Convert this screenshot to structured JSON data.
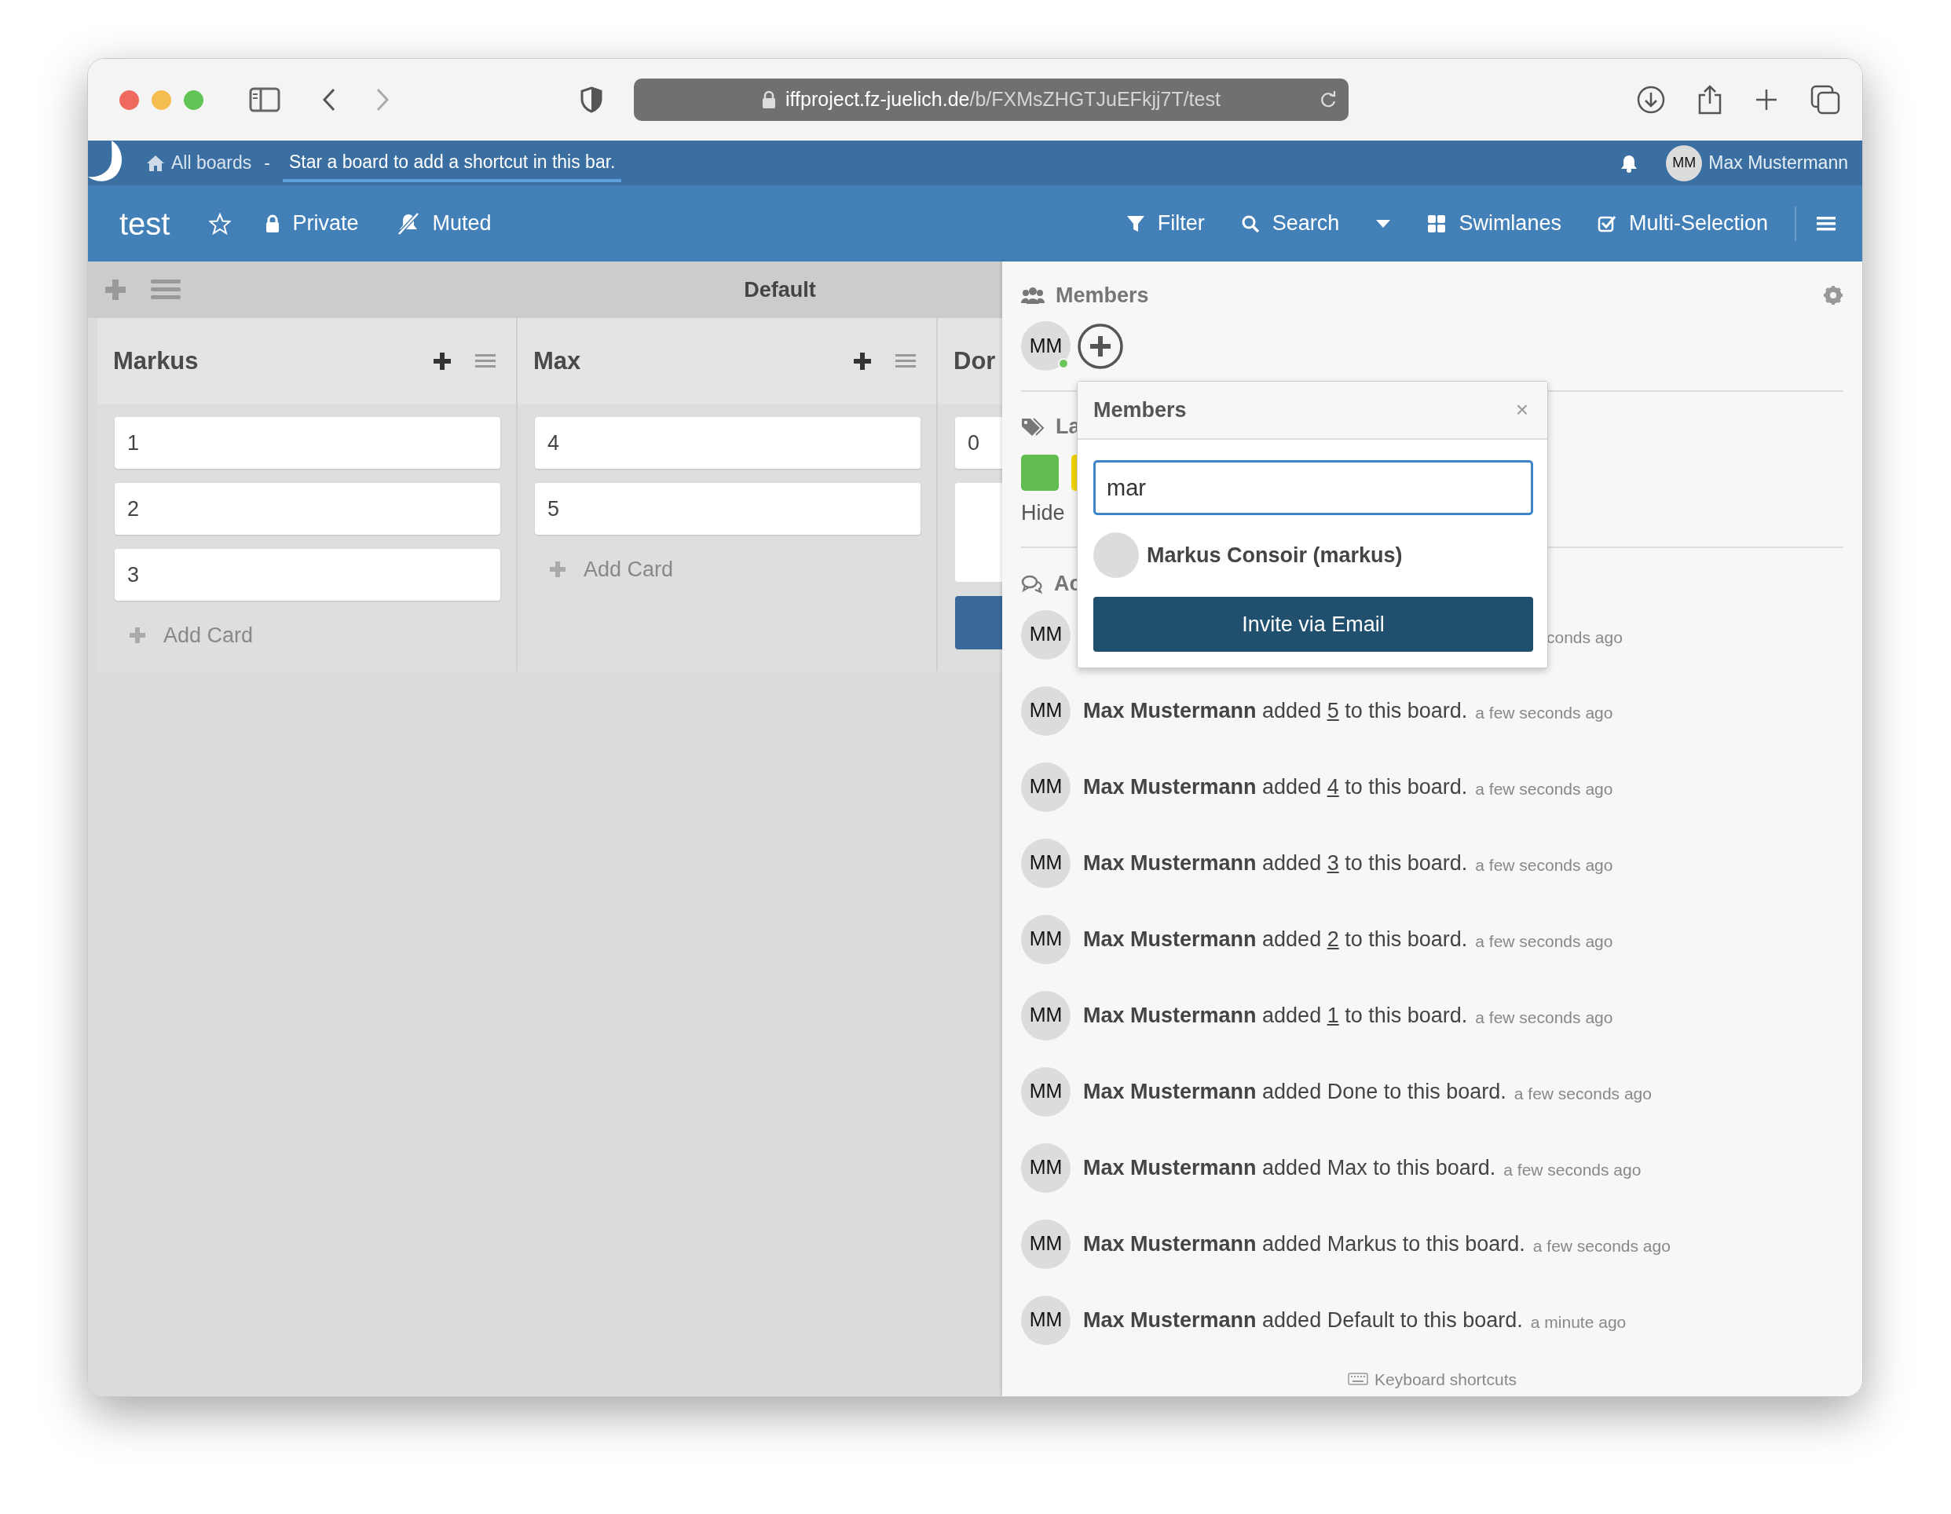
{
  "browser": {
    "url_host": "iffproject.fz-juelich.de",
    "url_path": "/b/FXMsZHGTJuEFkjj7T/test"
  },
  "header": {
    "all_boards": "All boards",
    "separator": "-",
    "shortcut_hint": "Star a board to add a shortcut in this bar.",
    "user": {
      "initials": "MM",
      "name": "Max Mustermann"
    }
  },
  "board_bar": {
    "title": "test",
    "starred": false,
    "visibility": "Private",
    "watch": "Muted",
    "actions": [
      {
        "kind": "filter",
        "label": "Filter"
      },
      {
        "kind": "search",
        "label": "Search"
      },
      {
        "kind": "caret"
      },
      {
        "kind": "swimlanes",
        "label": "Swimlanes"
      },
      {
        "kind": "multiselect",
        "label": "Multi-Selection"
      }
    ]
  },
  "swimlane": {
    "title": "Default",
    "lists": [
      {
        "title": "Markus",
        "cards": [
          "1",
          "2",
          "3"
        ],
        "add_card": "Add Card",
        "composer_open": false
      },
      {
        "title": "Max",
        "cards": [
          "4",
          "5"
        ],
        "add_card": "Add Card",
        "composer_open": false
      },
      {
        "title": "Dor",
        "cards": [
          "0"
        ],
        "composer_open": true
      }
    ]
  },
  "sidebar": {
    "members_title": "Members",
    "members": [
      {
        "initials": "MM",
        "online": true
      }
    ],
    "labels_title": "La",
    "labels": [
      {
        "color": "#61bd4f"
      },
      {
        "color": "#f2d600"
      }
    ],
    "hide_text": "Hide",
    "activities_title": "Ac",
    "activities": [
      {
        "kind": "covered",
        "initials": "MM",
        "time": "conds ago"
      },
      {
        "kind": "full",
        "initials": "MM",
        "actor": "Max Mustermann",
        "verb": "added",
        "target": "5",
        "target_link": true,
        "rest": "to this board.",
        "time": "a few seconds ago"
      },
      {
        "kind": "full",
        "initials": "MM",
        "actor": "Max Mustermann",
        "verb": "added",
        "target": "4",
        "target_link": true,
        "rest": "to this board.",
        "time": "a few seconds ago"
      },
      {
        "kind": "full",
        "initials": "MM",
        "actor": "Max Mustermann",
        "verb": "added",
        "target": "3",
        "target_link": true,
        "rest": "to this board.",
        "time": "a few seconds ago"
      },
      {
        "kind": "full",
        "initials": "MM",
        "actor": "Max Mustermann",
        "verb": "added",
        "target": "2",
        "target_link": true,
        "rest": "to this board.",
        "time": "a few seconds ago"
      },
      {
        "kind": "full",
        "initials": "MM",
        "actor": "Max Mustermann",
        "verb": "added",
        "target": "1",
        "target_link": true,
        "rest": "to this board.",
        "time": "a few seconds ago"
      },
      {
        "kind": "full",
        "initials": "MM",
        "actor": "Max Mustermann",
        "verb": "added",
        "target": "Done",
        "target_link": false,
        "rest": "to this board.",
        "time": "a few seconds ago"
      },
      {
        "kind": "full",
        "initials": "MM",
        "actor": "Max Mustermann",
        "verb": "added",
        "target": "Max",
        "target_link": false,
        "rest": "to this board.",
        "time": "a few seconds ago"
      },
      {
        "kind": "full",
        "initials": "MM",
        "actor": "Max Mustermann",
        "verb": "added",
        "target": "Markus",
        "target_link": false,
        "rest": "to this board.",
        "time": "a few seconds ago"
      },
      {
        "kind": "full",
        "initials": "MM",
        "actor": "Max Mustermann",
        "verb": "added",
        "target": "Default",
        "target_link": false,
        "rest": "to this board.",
        "time": "a minute ago"
      }
    ],
    "footer": "Keyboard shortcuts"
  },
  "popup": {
    "title": "Members",
    "close": "×",
    "search_value": "mar",
    "results": [
      {
        "name": "Markus Consoir (markus)"
      }
    ],
    "invite_button": "Invite via Email"
  }
}
